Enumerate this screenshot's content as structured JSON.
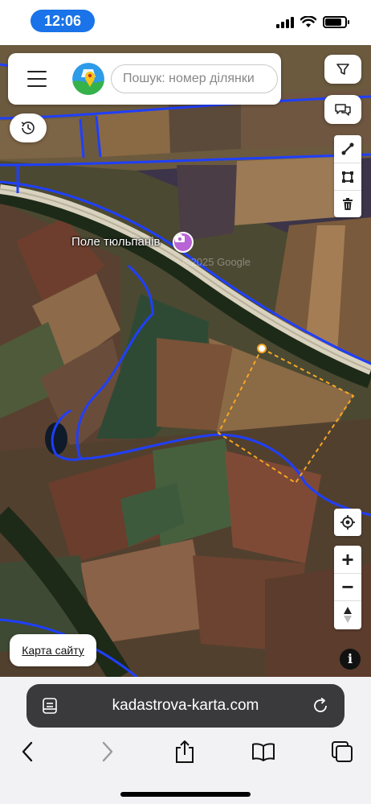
{
  "status_bar": {
    "time": "12:06",
    "battery_level": 0.85,
    "signal_bars": 4
  },
  "search": {
    "placeholder": "Пошук: номер ділянки",
    "value": ""
  },
  "map": {
    "poi_label": "Поле тюльпанів",
    "watermark": "©2025 Google",
    "sitemap_link": "Карта сайту",
    "info_label": "i",
    "zoom_in_label": "+",
    "zoom_out_label": "−",
    "boundary_color": "#1f3fff",
    "measure_color": "#f5a623"
  },
  "browser": {
    "url": "kadastrova-karta.com"
  },
  "icons": {
    "menu": "hamburger-icon",
    "logo": "map-logo-icon",
    "filter": "funnel-icon",
    "comments": "chat-bubbles-icon",
    "history": "clock-history-icon",
    "line_tool": "draw-line-icon",
    "polygon_tool": "draw-polygon-icon",
    "delete_tool": "trash-icon",
    "locate": "crosshair-icon",
    "compass": "compass-icon",
    "reader": "reader-mode-icon",
    "reload": "reload-icon",
    "back": "back-arrow-icon",
    "forward": "forward-arrow-icon",
    "share": "share-icon",
    "bookmarks": "book-icon",
    "tabs": "tabs-icon"
  }
}
